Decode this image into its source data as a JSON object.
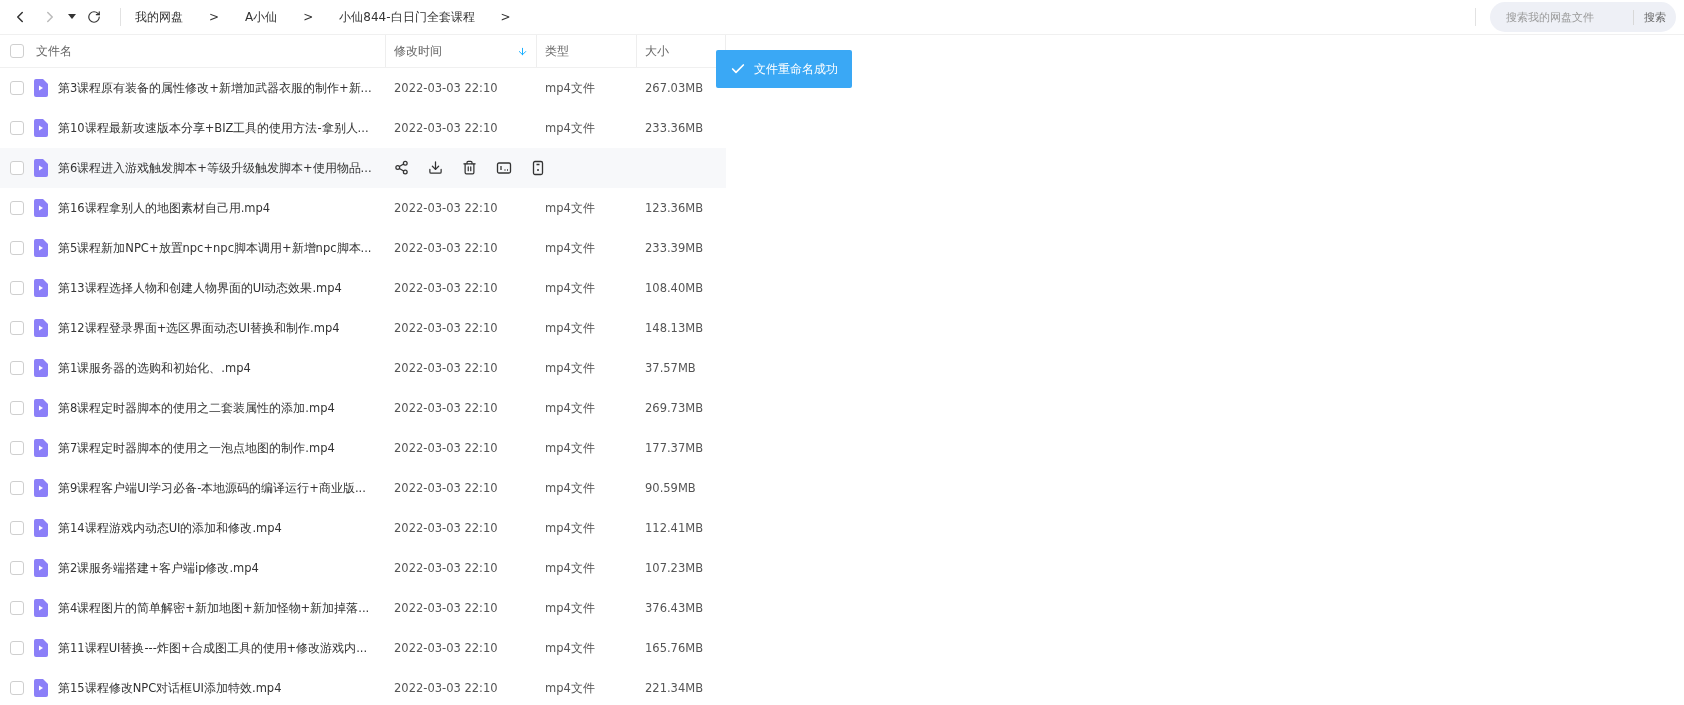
{
  "nav": {
    "back_disabled": false,
    "forward_disabled": true
  },
  "breadcrumb": [
    {
      "label": "我的网盘",
      "separator": ">"
    },
    {
      "label": "A小仙",
      "separator": ">"
    },
    {
      "label": "小仙844-白日门全套课程",
      "separator": ">"
    }
  ],
  "search": {
    "placeholder": "搜索我的网盘文件",
    "button": "搜索"
  },
  "table": {
    "select_all": {
      "checked": false
    },
    "columns": [
      {
        "label": "文件名",
        "sorted": false
      },
      {
        "label": "修改时间",
        "sorted": true
      },
      {
        "label": "类型",
        "sorted": false
      },
      {
        "label": "大小",
        "sorted": false
      }
    ],
    "rows": [
      {
        "name": "第3课程原有装备的属性修改+新增加武器衣服的制作+新...",
        "time": "2022-03-03 22:10",
        "type": "mp4文件",
        "size": "267.03MB",
        "checked": false,
        "hovered": false
      },
      {
        "name": "第10课程最新攻速版本分享+BIZ工具的使用方法-拿别人...",
        "time": "2022-03-03 22:10",
        "type": "mp4文件",
        "size": "233.36MB",
        "checked": false,
        "hovered": false
      },
      {
        "name": "第6课程进入游戏触发脚本+等级升级触发脚本+使用物品...",
        "checked": false,
        "hovered": true
      },
      {
        "name": "第16课程拿别人的地图素材自己用.mp4",
        "time": "2022-03-03 22:10",
        "type": "mp4文件",
        "size": "123.36MB",
        "checked": false,
        "hovered": false
      },
      {
        "name": "第5课程新加NPC+放置npc+npc脚本调用+新增npc脚本...",
        "time": "2022-03-03 22:10",
        "type": "mp4文件",
        "size": "233.39MB",
        "checked": false,
        "hovered": false
      },
      {
        "name": "第13课程选择人物和创建人物界面的UI动态效果.mp4",
        "time": "2022-03-03 22:10",
        "type": "mp4文件",
        "size": "108.40MB",
        "checked": false,
        "hovered": false
      },
      {
        "name": "第12课程登录界面+选区界面动态UI替换和制作.mp4",
        "time": "2022-03-03 22:10",
        "type": "mp4文件",
        "size": "148.13MB",
        "checked": false,
        "hovered": false
      },
      {
        "name": "第1课服务器的选购和初始化、.mp4",
        "time": "2022-03-03 22:10",
        "type": "mp4文件",
        "size": "37.57MB",
        "checked": false,
        "hovered": false
      },
      {
        "name": "第8课程定时器脚本的使用之二套装属性的添加.mp4",
        "time": "2022-03-03 22:10",
        "type": "mp4文件",
        "size": "269.73MB",
        "checked": false,
        "hovered": false
      },
      {
        "name": "第7课程定时器脚本的使用之一泡点地图的制作.mp4",
        "time": "2022-03-03 22:10",
        "type": "mp4文件",
        "size": "177.37MB",
        "checked": false,
        "hovered": false
      },
      {
        "name": "第9课程客户端UI学习必备-本地源码的编译运行+商业版...",
        "time": "2022-03-03 22:10",
        "type": "mp4文件",
        "size": "90.59MB",
        "checked": false,
        "hovered": false
      },
      {
        "name": "第14课程游戏内动态UI的添加和修改.mp4",
        "time": "2022-03-03 22:10",
        "type": "mp4文件",
        "size": "112.41MB",
        "checked": false,
        "hovered": false
      },
      {
        "name": "第2课服务端搭建+客户端ip修改.mp4",
        "time": "2022-03-03 22:10",
        "type": "mp4文件",
        "size": "107.23MB",
        "checked": false,
        "hovered": false
      },
      {
        "name": "第4课程图片的简单解密+新加地图+新加怪物+新加掉落...",
        "time": "2022-03-03 22:10",
        "type": "mp4文件",
        "size": "376.43MB",
        "checked": false,
        "hovered": false
      },
      {
        "name": "第11课程UI替换---炸图+合成图工具的使用+修改游戏内...",
        "time": "2022-03-03 22:10",
        "type": "mp4文件",
        "size": "165.76MB",
        "checked": false,
        "hovered": false
      },
      {
        "name": "第15课程修改NPC对话框UI添加特效.mp4",
        "time": "2022-03-03 22:10",
        "type": "mp4文件",
        "size": "221.34MB",
        "checked": false,
        "hovered": false
      }
    ]
  },
  "toast": {
    "text": "文件重命名成功"
  }
}
